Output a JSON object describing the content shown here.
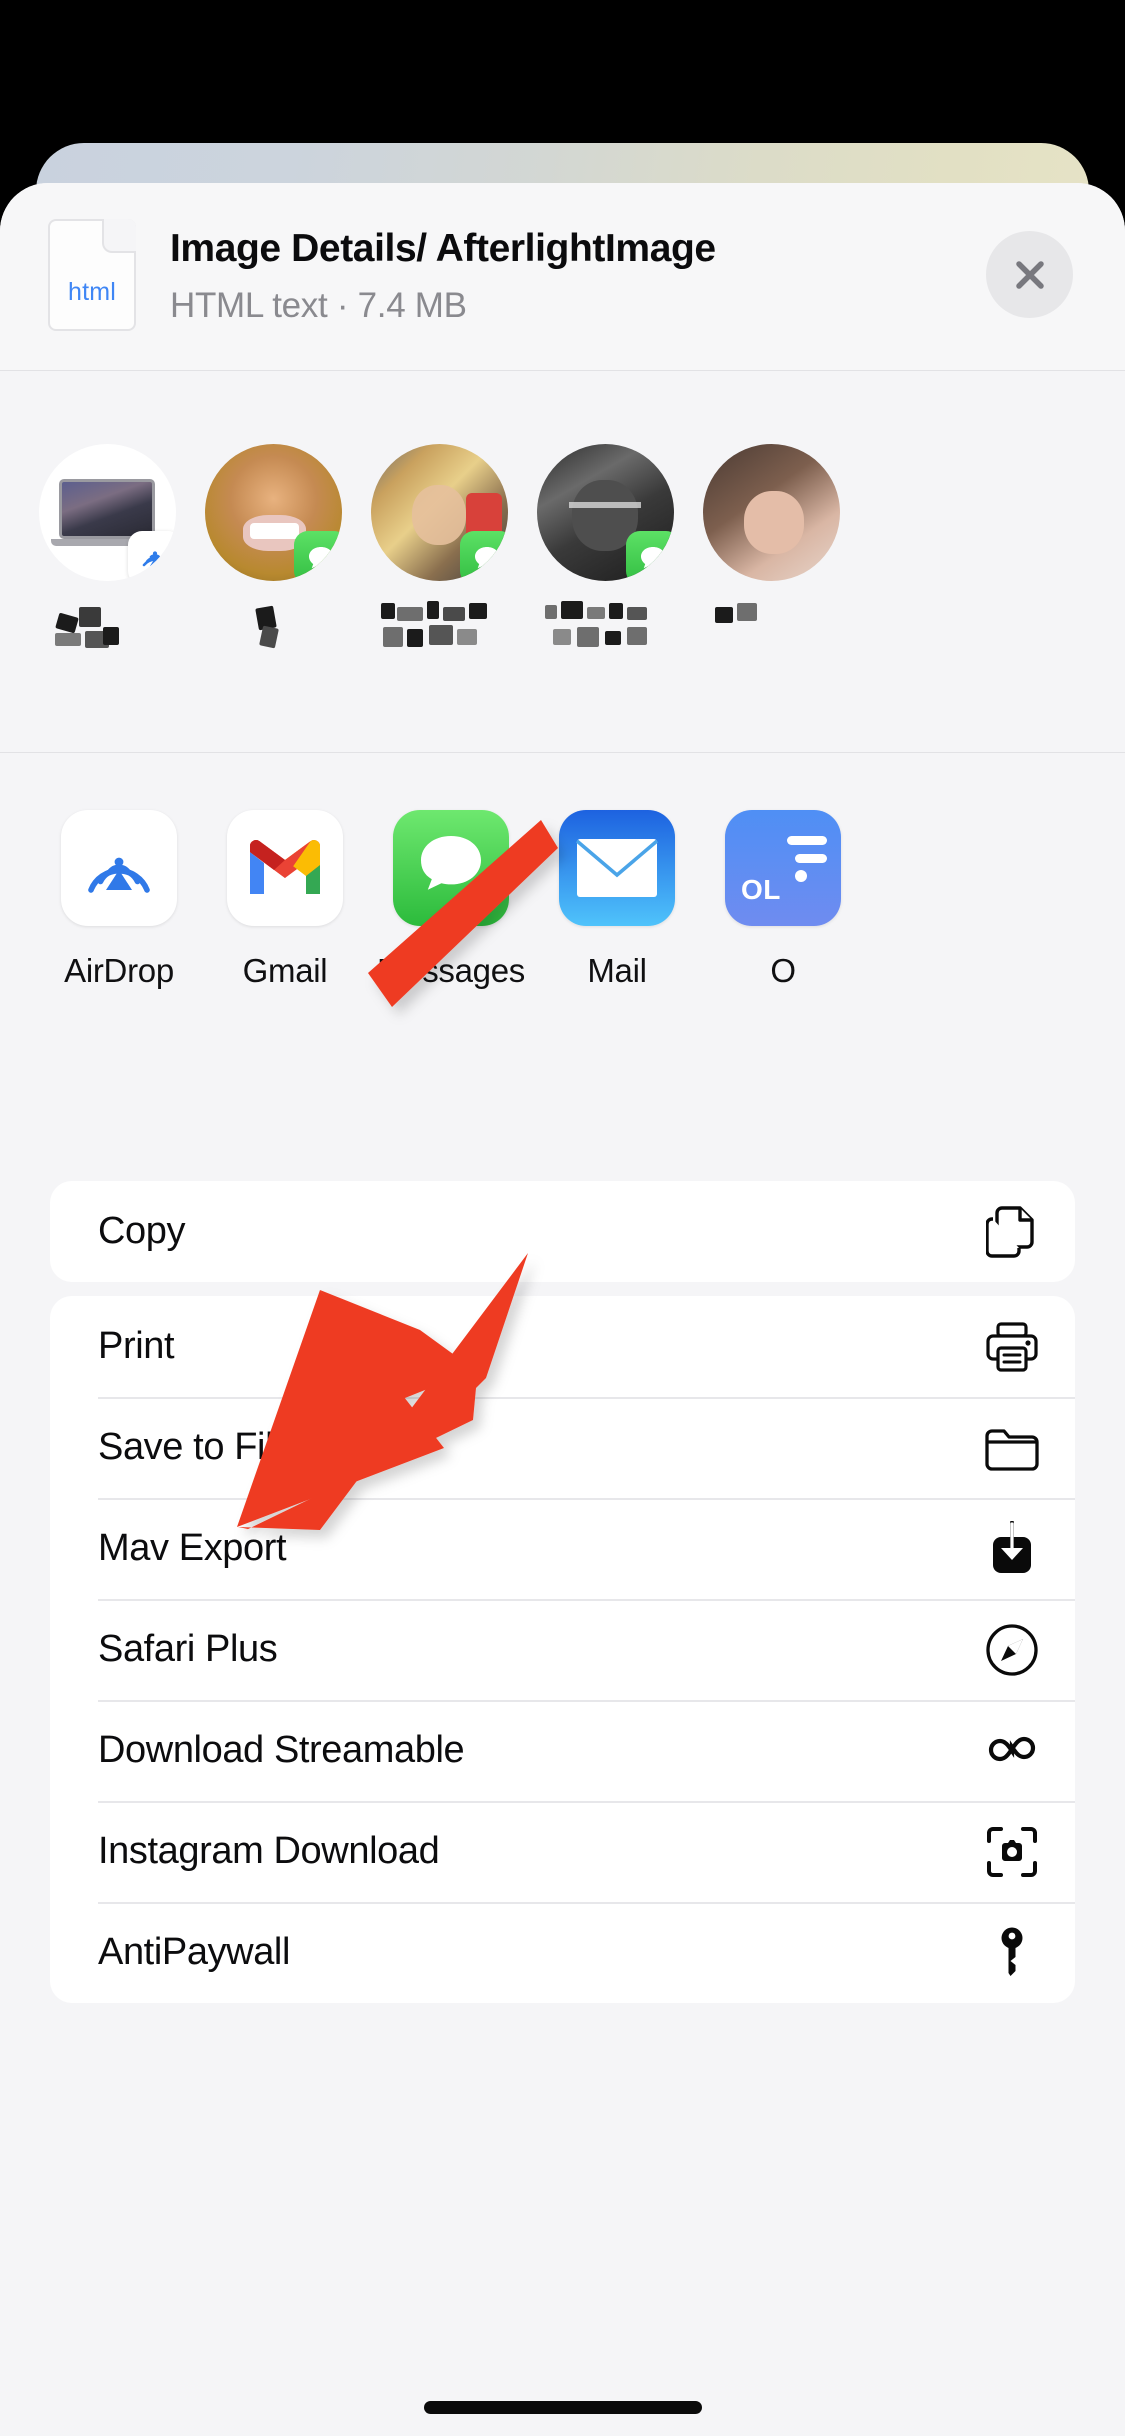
{
  "sheet": {
    "file": {
      "icon_ext": "html",
      "title": "Image Details/ AfterlightImage",
      "subtitle": "HTML text · 7.4 MB"
    },
    "close_label": "close-icon"
  },
  "contacts": [
    {
      "name": "",
      "avatar": "macbook-device",
      "badge": "airdrop-icon",
      "redacted": true
    },
    {
      "name": "",
      "avatar": "photo-person-gold-grill",
      "badge": "messages-icon",
      "redacted": true
    },
    {
      "name": "",
      "avatar": "photo-person-blonde-mirror",
      "badge": "messages-icon",
      "redacted": true
    },
    {
      "name": "",
      "avatar": "photo-person-bw-glasses",
      "badge": "messages-icon",
      "redacted": true
    },
    {
      "name": "",
      "avatar": "photo-person-partial",
      "badge": "",
      "redacted": true
    }
  ],
  "apps": [
    {
      "label": "AirDrop",
      "icon": "airdrop-icon"
    },
    {
      "label": "Gmail",
      "icon": "gmail-icon"
    },
    {
      "label": "Messages",
      "icon": "messages-icon"
    },
    {
      "label": "Mail",
      "icon": "mail-icon"
    },
    {
      "label": "O",
      "icon": "ol-app-icon",
      "tile_text": "OL"
    }
  ],
  "action_cards": [
    {
      "rows": [
        {
          "label": "Copy",
          "icon": "copy-icon"
        }
      ]
    },
    {
      "rows": [
        {
          "label": "Print",
          "icon": "printer-icon"
        },
        {
          "label": "Save to Files",
          "icon": "folder-icon"
        },
        {
          "label": "Mav Export",
          "icon": "download-icon"
        },
        {
          "label": "Safari Plus",
          "icon": "compass-icon"
        },
        {
          "label": "Download Streamable",
          "icon": "infinity-icon"
        },
        {
          "label": "Instagram Download",
          "icon": "camera-viewfinder-icon"
        },
        {
          "label": "AntiPaywall",
          "icon": "key-icon"
        }
      ]
    }
  ],
  "annotation": {
    "type": "arrow",
    "color": "#EE3B22",
    "points_to": "Save to Files"
  },
  "colors": {
    "sheet_bg": "#f5f5f7",
    "card_bg": "#ffffff",
    "text_primary": "#0c0c0e",
    "text_secondary": "#8a8a8f",
    "accent_blue": "#3f86f5",
    "annotation_red": "#EE3B22",
    "messages_green": "#32bd42"
  }
}
